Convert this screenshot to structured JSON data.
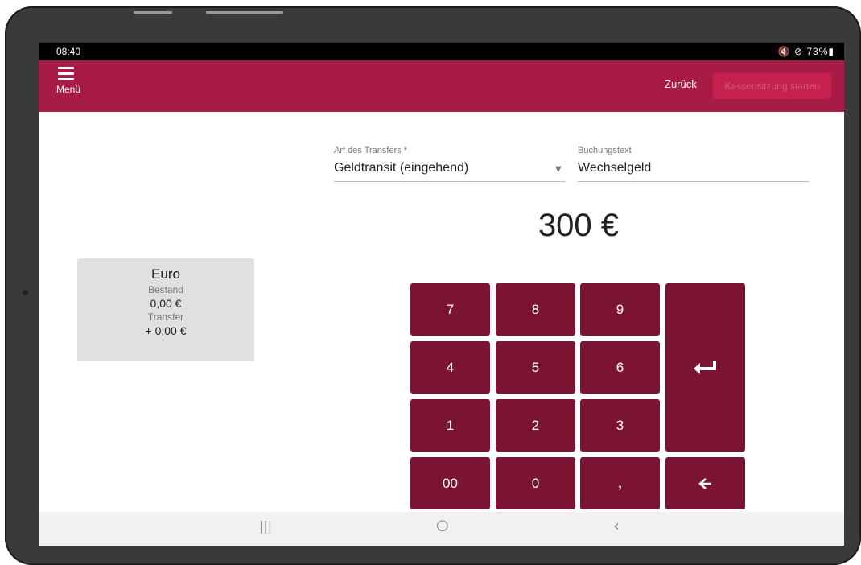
{
  "status_bar": {
    "time": "08:40",
    "status_icons": "🔇 ⊘ 73%▮",
    "battery": "73%"
  },
  "header": {
    "menu_label": "Menü",
    "back_label": "Zurück",
    "start_button_label": "Kassensitzung starten",
    "color": "#a91b47"
  },
  "form": {
    "transfer_type_label": "Art des Transfers *",
    "transfer_type_value": "Geldtransit (eingehend)",
    "booking_text_label": "Buchungstext",
    "booking_text_value": "Wechselgeld"
  },
  "amount": "300 €",
  "currency_card": {
    "name": "Euro",
    "stock_label": "Bestand",
    "stock_value": "0,00 €",
    "transfer_label": "Transfer",
    "transfer_value": "+ 0,00 €"
  },
  "keypad": {
    "keys": [
      "7",
      "8",
      "9",
      "4",
      "5",
      "6",
      "1",
      "2",
      "3",
      "00",
      "0",
      ","
    ],
    "enter_icon": "enter-arrow-icon",
    "backspace_icon": "back-arrow-icon",
    "key_color": "#7a1432"
  },
  "nav_bar": {
    "recents_glyph": "|||",
    "home_glyph": "○",
    "back_glyph": "‹"
  }
}
